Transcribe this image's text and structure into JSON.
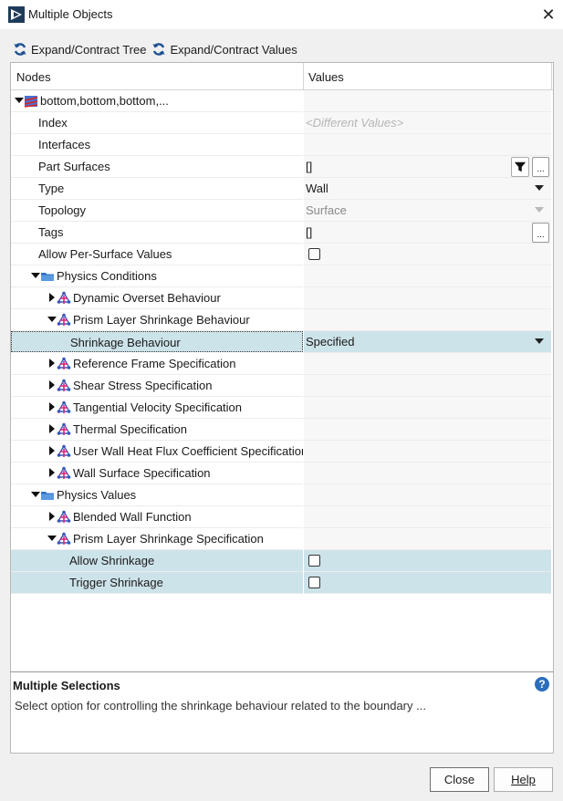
{
  "window": {
    "title": "Multiple Objects"
  },
  "toolbar": {
    "expand_tree": "Expand/Contract Tree",
    "expand_values": "Expand/Contract Values"
  },
  "table": {
    "col_nodes": "Nodes",
    "col_values": "Values",
    "rows": [
      {
        "label": "bottom,bottom,bottom,...",
        "value": "",
        "indent": 0,
        "expander": "down",
        "icon": "boundary-icon"
      },
      {
        "label": "Index",
        "value": "<Different Values>",
        "indent": 1,
        "value_style": "ghost"
      },
      {
        "label": "Interfaces",
        "value": "",
        "indent": 1
      },
      {
        "label": "Part Surfaces",
        "value": "[]",
        "indent": 1,
        "widgets": [
          "filter",
          "ellipsis"
        ]
      },
      {
        "label": "Type",
        "value": "Wall",
        "indent": 1,
        "widgets": [
          "dropdown"
        ]
      },
      {
        "label": "Topology",
        "value": "Surface",
        "indent": 1,
        "value_style": "muted",
        "widgets": [
          "dropdown-muted"
        ]
      },
      {
        "label": "Tags",
        "value": "[]",
        "indent": 1,
        "widgets": [
          "ellipsis"
        ]
      },
      {
        "label": "Allow Per-Surface Values",
        "value": "",
        "indent": 1,
        "widgets": [
          "checkbox"
        ]
      },
      {
        "label": "Physics Conditions",
        "value": "",
        "indent": 1,
        "expander": "down",
        "icon": "folder-icon"
      },
      {
        "label": "Dynamic Overset Behaviour",
        "value": "",
        "indent": 2,
        "expander": "right",
        "icon": "physics-node-icon"
      },
      {
        "label": "Prism Layer Shrinkage Behaviour",
        "value": "",
        "indent": 2,
        "expander": "down",
        "icon": "physics-node-icon"
      },
      {
        "label": "Shrinkage Behaviour",
        "value": "Specified",
        "indent": 3,
        "selected": true,
        "widgets": [
          "dropdown"
        ]
      },
      {
        "label": "Reference Frame Specification",
        "value": "",
        "indent": 2,
        "expander": "right",
        "icon": "physics-node-icon"
      },
      {
        "label": "Shear Stress Specification",
        "value": "",
        "indent": 2,
        "expander": "right",
        "icon": "physics-node-icon"
      },
      {
        "label": "Tangential Velocity Specification",
        "value": "",
        "indent": 2,
        "expander": "right",
        "icon": "physics-node-icon"
      },
      {
        "label": "Thermal Specification",
        "value": "",
        "indent": 2,
        "expander": "right",
        "icon": "physics-node-icon"
      },
      {
        "label": "User Wall Heat Flux Coefficient Specification",
        "value": "",
        "indent": 2,
        "expander": "right",
        "icon": "physics-node-icon"
      },
      {
        "label": "Wall Surface Specification",
        "value": "",
        "indent": 2,
        "expander": "right",
        "icon": "physics-node-icon"
      },
      {
        "label": "Physics Values",
        "value": "",
        "indent": 1,
        "expander": "down",
        "icon": "folder-icon"
      },
      {
        "label": "Blended Wall Function",
        "value": "",
        "indent": 2,
        "expander": "right",
        "icon": "physics-node-icon"
      },
      {
        "label": "Prism Layer Shrinkage Specification",
        "value": "",
        "indent": 2,
        "expander": "down",
        "icon": "physics-node-icon"
      },
      {
        "label": "Allow Shrinkage",
        "value": "",
        "indent": 3,
        "highlight": true,
        "widgets": [
          "checkbox"
        ]
      },
      {
        "label": "Trigger Shrinkage",
        "value": "",
        "indent": 3,
        "highlight": true,
        "widgets": [
          "checkbox"
        ]
      }
    ]
  },
  "description": {
    "title": "Multiple Selections",
    "text": "Select option for controlling the shrinkage behaviour related to the boundary ..."
  },
  "buttons": {
    "close": "Close",
    "help": "Help"
  },
  "colors": {
    "selection": "#cde3ea",
    "accent": "#2a6ebb",
    "folder": "#2f6fc4"
  }
}
